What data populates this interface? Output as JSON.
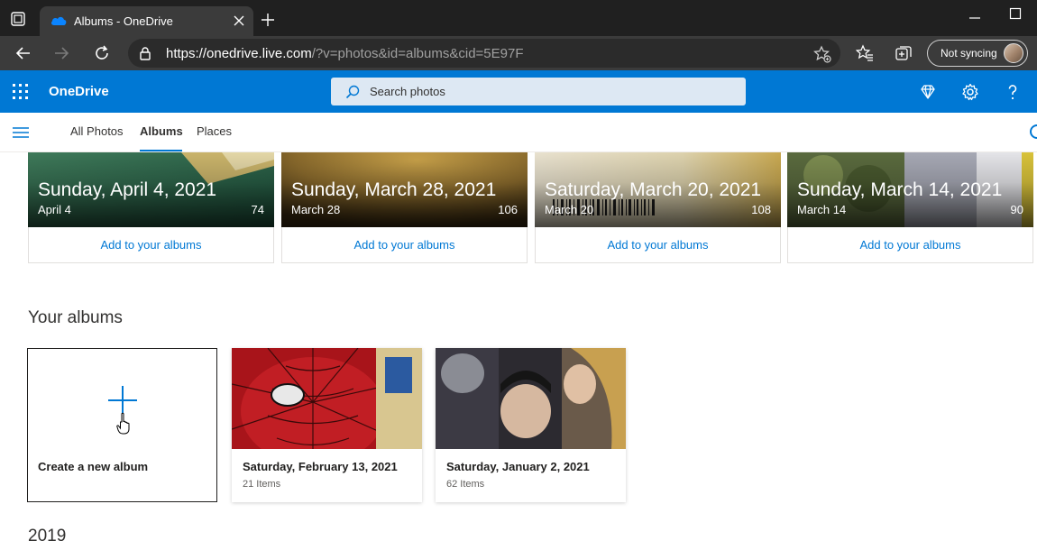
{
  "browser": {
    "tab_title": "Albums - OneDrive",
    "url_host": "https://onedrive.live.com",
    "url_rest": "/?v=photos&id=albums&cid=5E97F",
    "sync_label": "Not syncing"
  },
  "header": {
    "brand": "OneDrive",
    "search_placeholder": "Search photos",
    "accent": "#0078d4"
  },
  "nav": {
    "tabs": [
      {
        "label": "All Photos",
        "active": false
      },
      {
        "label": "Albums",
        "active": true
      },
      {
        "label": "Places",
        "active": false
      }
    ]
  },
  "moments": [
    {
      "title": "Sunday, April 4, 2021",
      "subtitle": "April 4",
      "count": "74",
      "action": "Add to your albums"
    },
    {
      "title": "Sunday, March 28, 2021",
      "subtitle": "March 28",
      "count": "106",
      "action": "Add to your albums"
    },
    {
      "title": "Saturday, March 20, 2021",
      "subtitle": "March 20",
      "count": "108",
      "action": "Add to your albums"
    },
    {
      "title": "Sunday, March 14, 2021",
      "subtitle": "March 14",
      "count": "90",
      "action": "Add to your albums"
    }
  ],
  "your_albums": {
    "heading": "Your albums",
    "create_label": "Create a new album",
    "albums": [
      {
        "title": "Saturday, February 13, 2021",
        "count": "21 Items"
      },
      {
        "title": "Saturday, January 2, 2021",
        "count": "62 Items"
      }
    ]
  },
  "next_section": {
    "heading": "2019"
  }
}
